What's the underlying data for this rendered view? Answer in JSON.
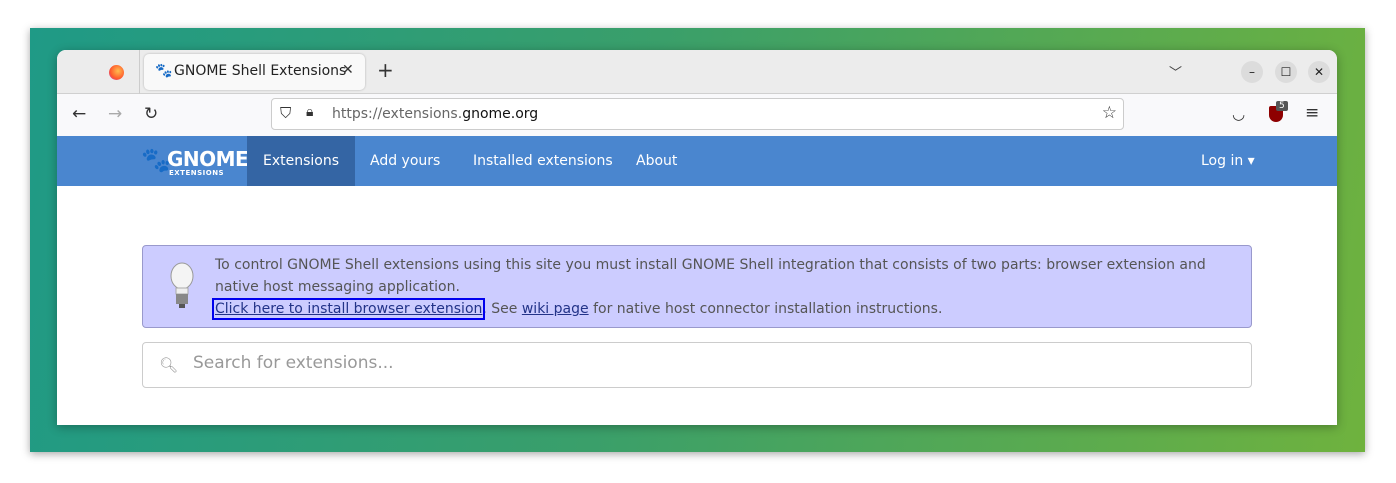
{
  "browser": {
    "tab": {
      "title": "GNOME Shell Extensions",
      "favicon": "gnome-foot-icon"
    },
    "url": {
      "prefix": "https://extensions.",
      "domain": "gnome.org"
    },
    "badge_count": "5"
  },
  "nav": {
    "logo_main": "GNOME",
    "logo_sub": "EXTENSIONS",
    "items": [
      {
        "label": "Extensions"
      },
      {
        "label": "Add yours"
      },
      {
        "label": "Installed extensions"
      },
      {
        "label": "About"
      }
    ],
    "login": "Log in ▾"
  },
  "alert": {
    "text1": "To control GNOME Shell extensions using this site you must install GNOME Shell integration that consists of two parts: browser extension and native host messaging application.",
    "link1": "Click here to install browser extension",
    "text2": ". See ",
    "link2": "wiki page",
    "text3": " for native host connector installation instructions."
  },
  "search": {
    "placeholder": "Search for extensions..."
  },
  "colors": {
    "nav": "#4a86cf",
    "nav_active": "#3465a4",
    "alert_bg": "#ccccff"
  }
}
